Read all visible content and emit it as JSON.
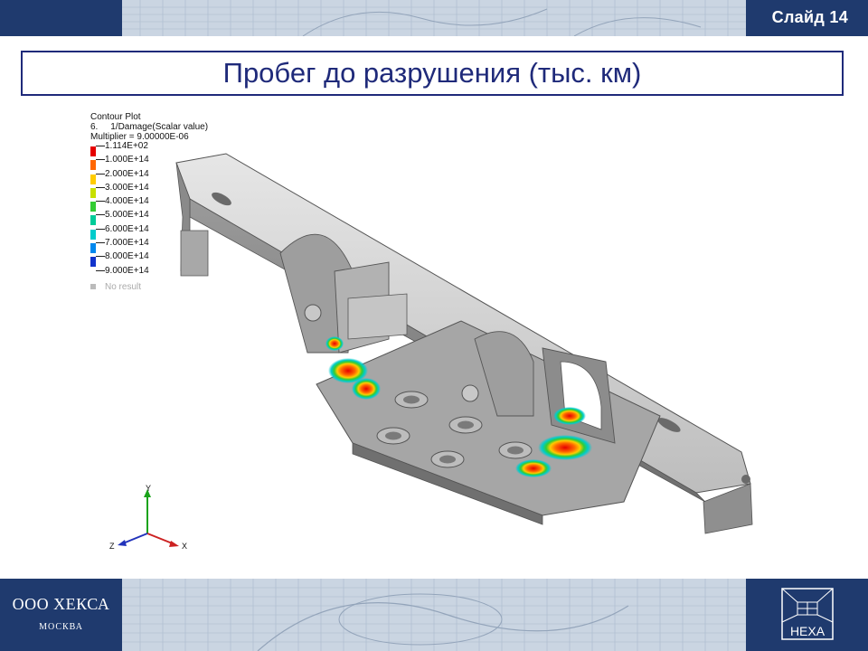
{
  "header": {
    "slide_number": "Слайд 14"
  },
  "title": "Пробег до разрушения (тыс. км)",
  "legend": {
    "line1": "Contour Plot",
    "line2": "6.     1/Damage(Scalar value)",
    "line3": "Multiplier = 9.00000E-06",
    "items": [
      {
        "label": "1.114E+02",
        "color": "#e60000"
      },
      {
        "label": "1.000E+14",
        "color": "#ff6600"
      },
      {
        "label": "2.000E+14",
        "color": "#ffcc00"
      },
      {
        "label": "3.000E+14",
        "color": "#c8e000"
      },
      {
        "label": "4.000E+14",
        "color": "#33cc33"
      },
      {
        "label": "5.000E+14",
        "color": "#00cc99"
      },
      {
        "label": "6.000E+14",
        "color": "#00cccc"
      },
      {
        "label": "7.000E+14",
        "color": "#0088ee"
      },
      {
        "label": "8.000E+14",
        "color": "#1133cc"
      },
      {
        "label": "9.000E+14",
        "color": "#b0b0b0"
      }
    ],
    "no_result": "No result"
  },
  "axes": {
    "y": "Y",
    "x": "X",
    "z": "Z"
  },
  "footer": {
    "company": "ООО ХЕКСА",
    "city": "МОСКВА",
    "logo_text": "HEXA"
  },
  "colors": {
    "brand_blue": "#1f3a6e",
    "title_blue": "#1f2a7a",
    "hot": "#e60000"
  }
}
